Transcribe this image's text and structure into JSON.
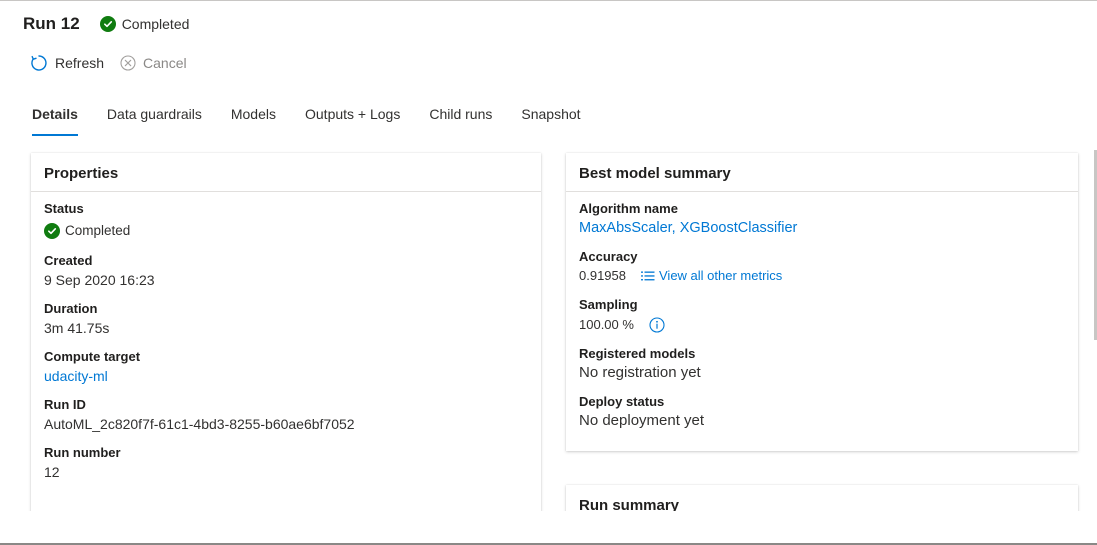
{
  "header": {
    "title": "Run 12",
    "status": "Completed"
  },
  "toolbar": {
    "refresh_label": "Refresh",
    "cancel_label": "Cancel"
  },
  "tabs": [
    {
      "label": "Details"
    },
    {
      "label": "Data guardrails"
    },
    {
      "label": "Models"
    },
    {
      "label": "Outputs + Logs"
    },
    {
      "label": "Child runs"
    },
    {
      "label": "Snapshot"
    }
  ],
  "properties": {
    "title": "Properties",
    "status_label": "Status",
    "status_value": "Completed",
    "created_label": "Created",
    "created_value": "9 Sep 2020 16:23",
    "duration_label": "Duration",
    "duration_value": "3m 41.75s",
    "compute_label": "Compute target",
    "compute_value": "udacity-ml",
    "runid_label": "Run ID",
    "runid_value": "AutoML_2c820f7f-61c1-4bd3-8255-b60ae6bf7052",
    "runnumber_label": "Run number",
    "runnumber_value": "12"
  },
  "best_model": {
    "title": "Best model summary",
    "algorithm_label": "Algorithm name",
    "algorithm_value": "MaxAbsScaler, XGBoostClassifier",
    "accuracy_label": "Accuracy",
    "accuracy_value": "0.91958",
    "metrics_link": "View all other metrics",
    "sampling_label": "Sampling",
    "sampling_value": "100.00 %",
    "registered_label": "Registered models",
    "registered_value": "No registration yet",
    "deploy_label": "Deploy status",
    "deploy_value": "No deployment yet"
  },
  "run_summary": {
    "title": "Run summary"
  },
  "colors": {
    "accent": "#0078d4",
    "success": "#107c10",
    "text": "#323130"
  }
}
